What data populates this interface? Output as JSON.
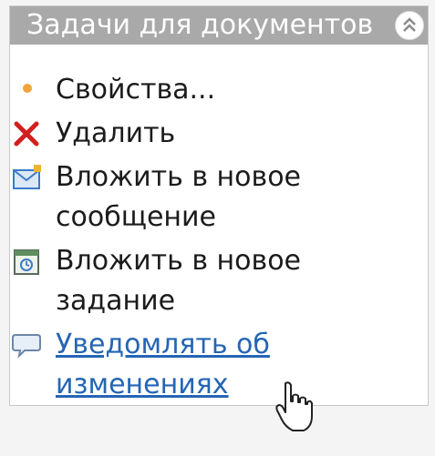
{
  "panel": {
    "title": "Задачи для документов",
    "collapse_icon": "double-chevron-up-icon"
  },
  "items": [
    {
      "icon": "bullet-icon",
      "lines": [
        "Свойства..."
      ]
    },
    {
      "icon": "delete-x-icon",
      "lines": [
        "Удалить"
      ]
    },
    {
      "icon": "envelope-icon",
      "lines": [
        "Вложить в новое",
        "сообщение"
      ]
    },
    {
      "icon": "calendar-task-icon",
      "lines": [
        "Вложить в новое",
        "задание"
      ]
    },
    {
      "icon": "speech-bubble-icon",
      "lines": [
        "Уведомлять об",
        "изменениях"
      ],
      "is_link": true
    }
  ],
  "colors": {
    "header_bg": "#a9a9a9",
    "link": "#2565b5",
    "delete_red": "#d21f1f",
    "bullet_orange": "#f2a33a"
  },
  "cursor": "hand-pointer-icon"
}
